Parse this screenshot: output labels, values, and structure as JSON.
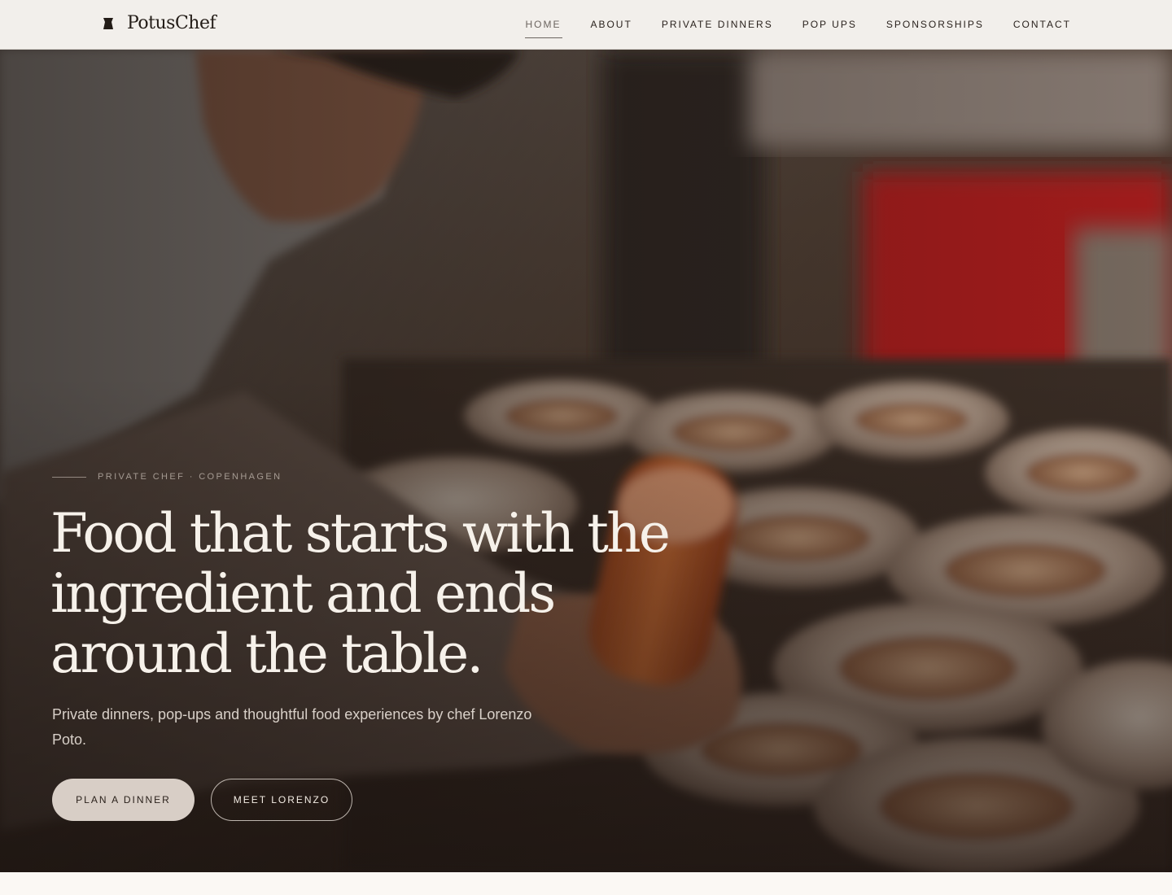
{
  "nav": {
    "brand": "PotusChef",
    "links": [
      {
        "label": "HOME",
        "active": true
      },
      {
        "label": "ABOUT"
      },
      {
        "label": "PRIVATE DINNERS"
      },
      {
        "label": "POP UPS"
      },
      {
        "label": "SPONSORSHIPS"
      },
      {
        "label": "CONTACT"
      }
    ]
  },
  "hero": {
    "eyebrow": "PRIVATE CHEF · COPENHAGEN",
    "title": "Food that starts with the ingredient and ends around the table.",
    "subtitle": "Private dinners, pop-ups and thoughtful food experiences by chef Lorenzo Poto.",
    "primary_cta": "PLAN A DINNER",
    "secondary_cta": "MEET LORENZO"
  },
  "colors": {
    "nav_bg": "#f2efeb",
    "text_dark": "#231c17",
    "cta_primary_bg": "#d8cec6",
    "hero_text": "#f6f1ea"
  }
}
